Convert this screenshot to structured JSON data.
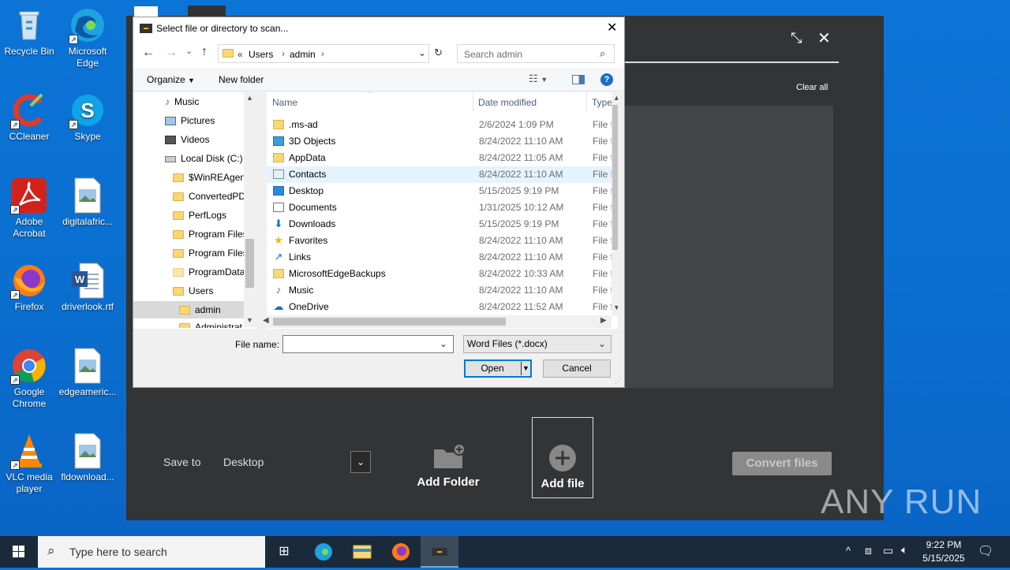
{
  "desktop": {
    "icons": [
      {
        "label": "Recycle Bin"
      },
      {
        "label": "Microsoft Edge"
      },
      {
        "label": "CCleaner"
      },
      {
        "label": "Skype"
      },
      {
        "label": "Adobe Acrobat"
      },
      {
        "label": "digitalafric..."
      },
      {
        "label": "Firefox"
      },
      {
        "label": "driverlook.rtf"
      },
      {
        "label": "Google Chrome"
      },
      {
        "label": "edgeameric..."
      },
      {
        "label": "VLC media player"
      },
      {
        "label": "fldownload..."
      }
    ]
  },
  "app": {
    "clear_all": "Clear all",
    "save_to_label": "Save to",
    "save_to_value": "Desktop",
    "add_folder": "Add Folder",
    "add_file": "Add file",
    "convert": "Convert files"
  },
  "dialog": {
    "title": "Select file or directory to scan...",
    "breadcrumb": [
      "«",
      "Users",
      "admin"
    ],
    "search_placeholder": "Search admin",
    "organize": "Organize",
    "new_folder": "New folder",
    "nav_items": [
      {
        "label": "Music"
      },
      {
        "label": "Pictures"
      },
      {
        "label": "Videos"
      },
      {
        "label": "Local Disk (C:)"
      },
      {
        "label": "$WinREAgent"
      },
      {
        "label": "ConvertedPD"
      },
      {
        "label": "PerfLogs"
      },
      {
        "label": "Program Files"
      },
      {
        "label": "Program Files"
      },
      {
        "label": "ProgramData"
      },
      {
        "label": "Users"
      },
      {
        "label": "admin"
      },
      {
        "label": "Administrat"
      }
    ],
    "columns": {
      "name": "Name",
      "date": "Date modified",
      "type": "Type"
    },
    "files": [
      {
        "name": ".ms-ad",
        "date": "2/6/2024 1:09 PM",
        "type": "File f",
        "icon": "folder-icon"
      },
      {
        "name": "3D Objects",
        "date": "8/24/2022 11:10 AM",
        "type": "File f",
        "icon": "3d-objects-icon"
      },
      {
        "name": "AppData",
        "date": "8/24/2022 11:05 AM",
        "type": "File f",
        "icon": "folder-icon"
      },
      {
        "name": "Contacts",
        "date": "8/24/2022 11:10 AM",
        "type": "File f",
        "icon": "contacts-icon"
      },
      {
        "name": "Desktop",
        "date": "5/15/2025 9:19 PM",
        "type": "File f",
        "icon": "desktop-folder-icon"
      },
      {
        "name": "Documents",
        "date": "1/31/2025 10:12 AM",
        "type": "File f",
        "icon": "documents-icon"
      },
      {
        "name": "Downloads",
        "date": "5/15/2025 9:19 PM",
        "type": "File f",
        "icon": "downloads-icon"
      },
      {
        "name": "Favorites",
        "date": "8/24/2022 11:10 AM",
        "type": "File f",
        "icon": "favorites-icon"
      },
      {
        "name": "Links",
        "date": "8/24/2022 11:10 AM",
        "type": "File f",
        "icon": "links-icon"
      },
      {
        "name": "MicrosoftEdgeBackups",
        "date": "8/24/2022 10:33 AM",
        "type": "File f",
        "icon": "folder-icon"
      },
      {
        "name": "Music",
        "date": "8/24/2022 11:10 AM",
        "type": "File f",
        "icon": "music-icon"
      },
      {
        "name": "OneDrive",
        "date": "8/24/2022 11:52 AM",
        "type": "File f",
        "icon": "onedrive-icon"
      }
    ],
    "file_name_label": "File name:",
    "file_name_value": "",
    "filter": "Word Files (*.docx)",
    "open": "Open",
    "cancel": "Cancel"
  },
  "taskbar": {
    "search_placeholder": "Type here to search",
    "time": "9:22 PM",
    "date": "5/15/2025"
  },
  "watermark": "ANY RUN"
}
